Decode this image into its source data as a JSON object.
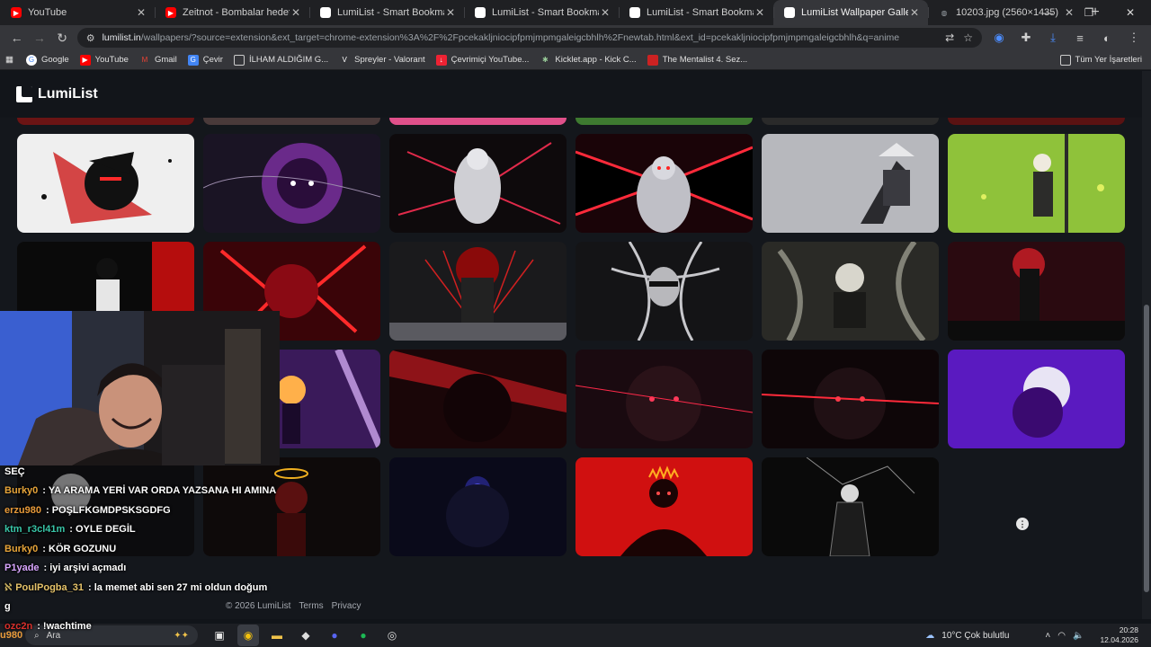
{
  "browser": {
    "tabs": [
      {
        "title": "YouTube",
        "icon": "youtube-icon",
        "color": "#ff0000"
      },
      {
        "title": "Zeitnot - Bombalar hedef bulur",
        "icon": "youtube-icon",
        "color": "#ff0000"
      },
      {
        "title": "LumiList - Smart Bookmark Ma",
        "icon": "lumilist-icon",
        "color": "#ffffff"
      },
      {
        "title": "LumiList - Smart Bookmark Ma",
        "icon": "lumilist-icon",
        "color": "#ffffff"
      },
      {
        "title": "LumiList - Smart Bookmark Ma",
        "icon": "lumilist-icon",
        "color": "#ffffff"
      },
      {
        "title": "LumiList Wallpaper Gallery",
        "icon": "lumilist-icon",
        "color": "#ffffff",
        "active": true
      },
      {
        "title": "10203.jpg (2560×1435)",
        "icon": "globe-icon",
        "color": "#9aa0a6"
      }
    ],
    "url_host": "lumilist.in",
    "url_path": "/wallpapers/?source=extension&ext_target=chrome-extension%3A%2F%2Fpcekakljniocipfpmjmpmgaleigcbhlh%2Fnewtab.html&ext_id=pcekakljniocipfpmjmpmgaleigcbhlh&q=anime"
  },
  "bookmarks": {
    "items": [
      {
        "label": "Google",
        "icon": "google-icon"
      },
      {
        "label": "YouTube",
        "icon": "youtube-icon"
      },
      {
        "label": "Gmail",
        "icon": "gmail-icon"
      },
      {
        "label": "Çevir",
        "icon": "translate-icon"
      },
      {
        "label": "İLHAM ALDIĞIM G...",
        "icon": "folder-icon"
      },
      {
        "label": "Spreyler - Valorant",
        "icon": "valorant-icon"
      },
      {
        "label": "Çevrimiçi YouTube...",
        "icon": "youtube-downloader-icon"
      },
      {
        "label": "Kicklet.app - Kick C...",
        "icon": "kicklet-icon"
      },
      {
        "label": "The Mentalist 4. Sez...",
        "icon": "bookmark-icon"
      }
    ],
    "all_bookmarks_label": "Tüm Yer İşaretleri"
  },
  "site": {
    "logo_text": "LumiList",
    "footer_copyright": "© 2026 LumiList",
    "footer_terms": "Terms",
    "footer_privacy": "Privacy"
  },
  "chat": {
    "lines": [
      {
        "user": "",
        "message": "SEÇ",
        "color": "#ffffff"
      },
      {
        "user": "Burky0",
        "message": ": YA ARAMA YERİ VAR ORDA YAZSANA HI AMINA",
        "color": "#e8a53a"
      },
      {
        "user": "erzu980",
        "message": ": POŞLFKGMDPSKSGDFG",
        "color": "#e89a3a"
      },
      {
        "user": "ktm_r3cl41m",
        "message": ": OYLE DEGİL",
        "color": "#39c6a8"
      },
      {
        "user": "Burky0",
        "message": ": KÖR GOZUNU",
        "color": "#e8a53a"
      },
      {
        "user": "P1yade",
        "message": ": iyi arşivi açmadı",
        "color": "#d9a6ff"
      },
      {
        "user": "PoulPogba_31",
        "message": ": la memet abi sen 27 mi oldun doğum",
        "color": "#e6c36a"
      },
      {
        "user": "",
        "message": "g",
        "color": "#ffffff"
      },
      {
        "user": "ozc2n",
        "message": ": !wachtime",
        "color": "#d9302c"
      }
    ]
  },
  "taskbar": {
    "search_placeholder": "Ara",
    "weather": "10°C  Çok bulutlu",
    "time": "20:28",
    "date": "12.04.2026",
    "overlay_user_fragment": "u980"
  }
}
